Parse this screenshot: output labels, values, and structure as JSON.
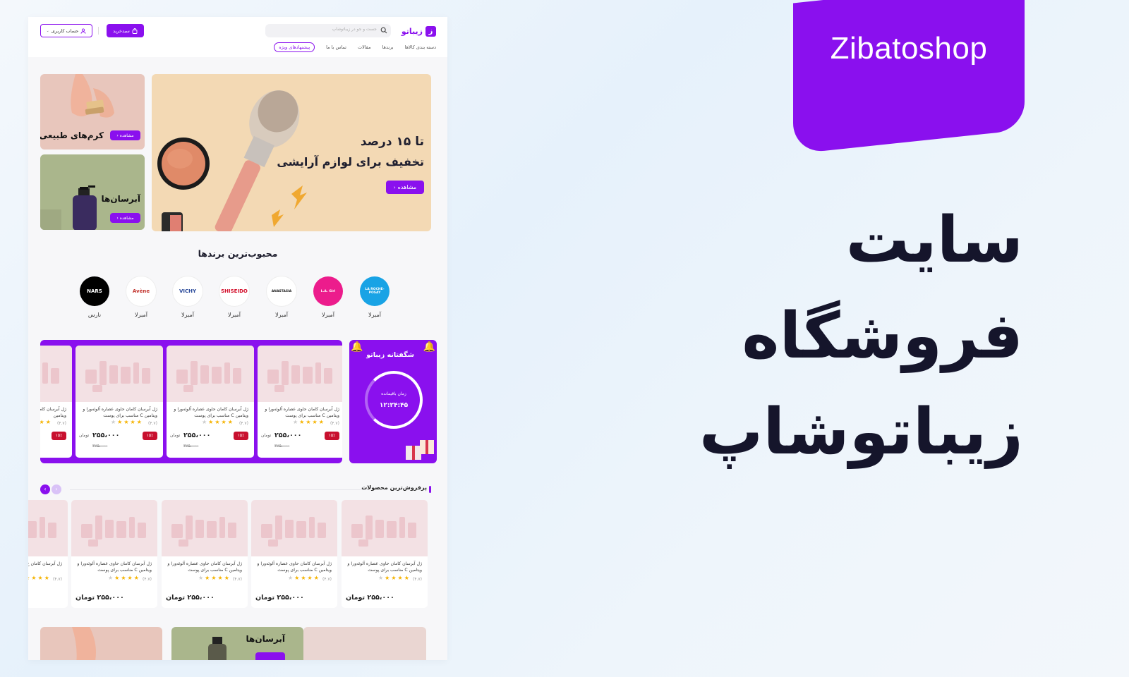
{
  "header": {
    "logo_text": "زیباتو",
    "search_placeholder": "جست و جو در زیباتوشاپ",
    "cart_label": "سبدخرید",
    "account_label": "حساب کاربری",
    "nav": [
      "دسته بندی کالاها",
      "برندها",
      "مقالات",
      "تماس با ما",
      "پیشنهادهای ویژه"
    ]
  },
  "hero": {
    "line1": "تا ۱۵ درصد",
    "line2": "تخفیف برای لوازم آرایشی",
    "button": "مشاهده"
  },
  "side_banners": [
    {
      "title": "کرم‌های طبیعی",
      "button": "مشاهده"
    },
    {
      "title": "آبرسان‌ها",
      "button": "مشاهده"
    }
  ],
  "brands": {
    "title": "محبوب‌ترین برندها",
    "items": [
      {
        "logo": "LA ROCHE-POSAY",
        "name": "آمبرلا",
        "color": "#19a3e5"
      },
      {
        "logo": "L.A. Girl",
        "name": "آمبرلا",
        "color": "#ec1c8c"
      },
      {
        "logo": "ANASTASIA",
        "name": "آمبرلا",
        "color": "#ffffff"
      },
      {
        "logo": "SHISEIDO",
        "name": "آمبرلا",
        "color": "#ffffff"
      },
      {
        "logo": "VICHY",
        "name": "آمبرلا",
        "color": "#ffffff"
      },
      {
        "logo": "Avène",
        "name": "آمبرلا",
        "color": "#ffffff"
      },
      {
        "logo": "NARS",
        "name": "نارس",
        "color": "#000000"
      }
    ]
  },
  "amazing": {
    "title": "شگفتانه زیباتو",
    "timer_label": "زمان باقیمانده",
    "timer_value": "۱۲:۲۴:۴۵",
    "products": [
      {
        "name1": "ژل آبرسان کامان حاوی عصاره آلوئه‌ورا و",
        "name2": "ویتامین C مناسب برای پوست",
        "rating": "(۴.۷)",
        "discount": "۱۵٪",
        "price": "۲۵۵،۰۰۰",
        "currency": "تومان",
        "old_price": "۳۷۵،۰۰۰"
      },
      {
        "name1": "ژل آبرسان کامان حاوی عصاره آلوئه‌ورا و",
        "name2": "ویتامین C مناسب برای پوست",
        "rating": "(۴.۷)",
        "discount": "۱۵٪",
        "price": "۲۵۵،۰۰۰",
        "currency": "تومان",
        "old_price": "۳۷۵،۰۰۰"
      },
      {
        "name1": "ژل آبرسان کامان حاوی عصاره آلوئه‌ورا و",
        "name2": "ویتامین C مناسب برای پوست",
        "rating": "(۴.۷)",
        "discount": "۱۵٪",
        "price": "۲۵۵،۰۰۰",
        "currency": "تومان",
        "old_price": "۳۷۵،۰۰۰"
      },
      {
        "name1": "ژل آبرسان کامان",
        "name2": "ویتامین",
        "rating": "(۴.۷)",
        "discount": "۱۵٪",
        "price": "",
        "currency": "",
        "old_price": ""
      }
    ]
  },
  "bestsellers": {
    "title": "پرفروش‌ترین محصولات",
    "products": [
      {
        "name1": "ژل آبرسان کامان حاوی عصاره آلوئه‌ورا و",
        "name2": "ویتامین C مناسب برای پوست",
        "rating": "(۴.۷)",
        "price": "۲۵۵،۰۰۰ تومان"
      },
      {
        "name1": "ژل آبرسان کامان حاوی عصاره آلوئه‌ورا و",
        "name2": "ویتامین C مناسب برای پوست",
        "rating": "(۴.۷)",
        "price": "۲۵۵،۰۰۰ تومان"
      },
      {
        "name1": "ژل آبرسان کامان حاوی عصاره آلوئه‌ورا و",
        "name2": "ویتامین C مناسب برای پوست",
        "rating": "(۴.۷)",
        "price": "۲۵۵،۰۰۰ تومان"
      },
      {
        "name1": "ژل آبرسان کامان حاوی عصاره آلوئه‌ورا و",
        "name2": "ویتامین C مناسب برای پوست",
        "rating": "(۴.۷)",
        "price": "۲۵۵،۰۰۰ تومان"
      },
      {
        "name1": "ژل آبرسان کامان ح",
        "name2": "",
        "rating": "(۴.۷)",
        "price": ""
      }
    ]
  },
  "bottom_banners": [
    {
      "title": ""
    },
    {
      "title": "آبرسان‌ها"
    },
    {
      "title": ""
    }
  ],
  "brand_tab": "Zibatoshop",
  "headline": [
    "سایت",
    "فروشگاه",
    "زیباتوشاپ"
  ],
  "colors": {
    "accent": "#8a10ee",
    "discount": "#c8102e",
    "star": "#f5b300"
  }
}
